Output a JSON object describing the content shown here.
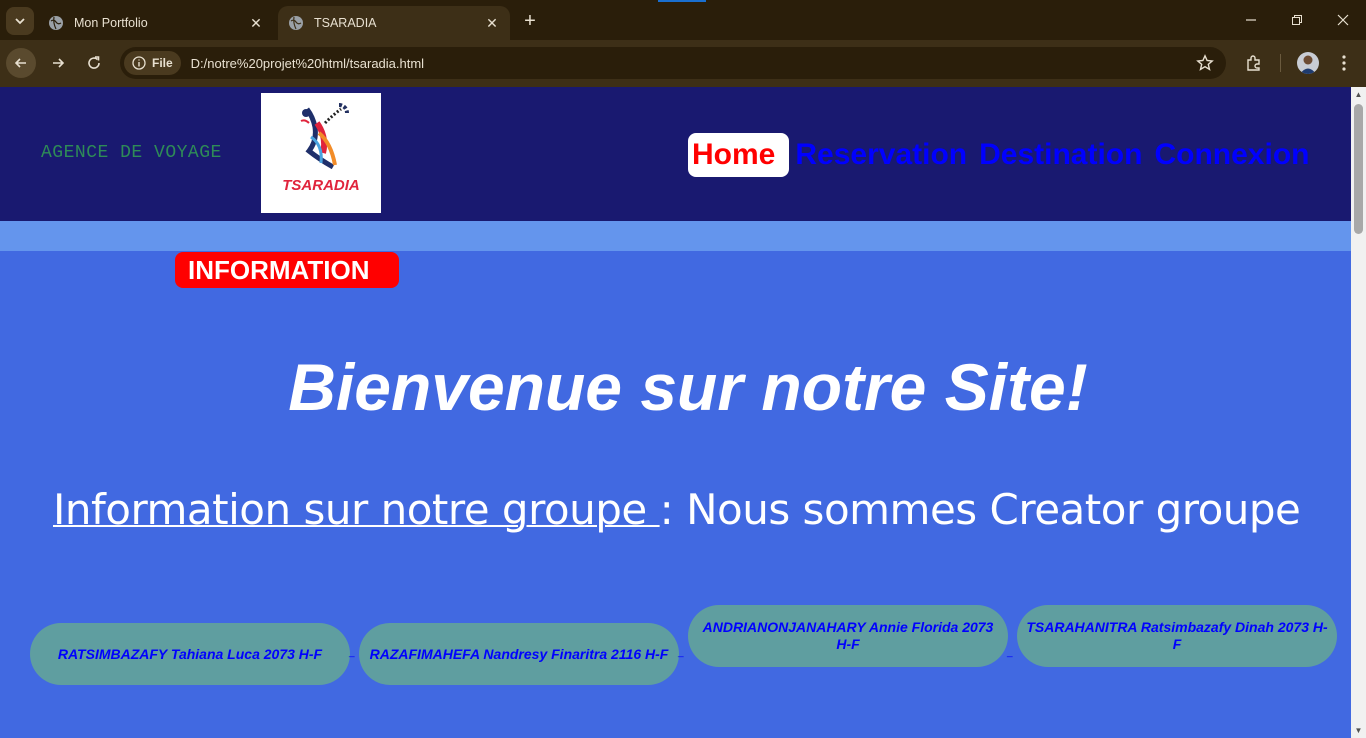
{
  "browser": {
    "tabs": [
      {
        "title": "Mon Portfolio"
      },
      {
        "title": "TSARADIA"
      }
    ],
    "address": {
      "scheme_label": "File",
      "url": "D:/notre%20projet%20html/tsaradia.html"
    }
  },
  "header": {
    "agency_label": "AGENCE DE VOYAGE",
    "logo_text": "TSARADIA",
    "nav": {
      "home": "Home",
      "reservation": "Reservation",
      "destination": "Destination",
      "connexion": "Connexion"
    }
  },
  "main": {
    "info_badge": "INFORMATION",
    "welcome": "Bienvenue sur notre Site!",
    "group_label": "Information sur notre groupe ",
    "group_text": ": Nous sommes Creator groupe",
    "members": [
      {
        "text": "RATSIMBAZAFY Tahiana Luca 2073 H-F"
      },
      {
        "text": "RAZAFIMAHEFA Nandresy Finaritra 2116 H-F"
      },
      {
        "text": "ANDRIANONJANAHARY Annie Florida 2073 H-F"
      },
      {
        "text": "TSARAHANITRA Ratsimbazafy Dinah 2073 H-F"
      }
    ]
  },
  "colors": {
    "header_bg": "#191970",
    "page_bg": "#4169e1",
    "strip_bg": "#6495ed",
    "badge_bg": "#ff0000",
    "member_bg": "#5f9ea0",
    "nav_link": "#0000ff"
  }
}
